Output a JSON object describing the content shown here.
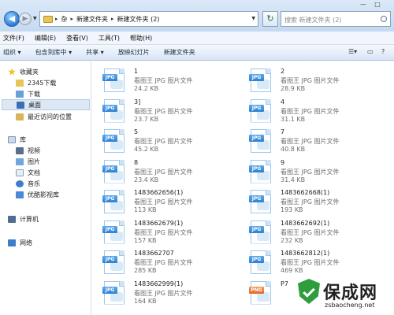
{
  "address": {
    "crumbs": [
      "杂",
      "新建文件夹",
      "新建文件夹 (2)"
    ],
    "search_placeholder": "搜索 新建文件夹 (2)"
  },
  "window": {
    "minimize": "—",
    "restore": "□"
  },
  "menu": [
    "文件(F)",
    "编辑(E)",
    "查看(V)",
    "工具(T)",
    "帮助(H)"
  ],
  "commands": [
    "组织 ▾",
    "包含到库中 ▾",
    "共享 ▾",
    "放映幻灯片",
    "新建文件夹"
  ],
  "view_controls": {
    "view": "☰▾",
    "preview": "▭",
    "help": "?"
  },
  "nav": {
    "favorites_title": "收藏夹",
    "favorites": [
      "2345下载",
      "下载",
      "桌面",
      "最近访问的位置"
    ],
    "libraries_title": "库",
    "libraries": [
      "视频",
      "图片",
      "文档",
      "音乐",
      "优酷影视库"
    ],
    "computer": "计算机",
    "network": "网络"
  },
  "files": [
    {
      "name": "1",
      "type": "看图王 JPG 图片文件",
      "size": "24.2 KB",
      "ext": "JPG"
    },
    {
      "name": "2",
      "type": "看图王 JPG 图片文件",
      "size": "28.9 KB",
      "ext": "JPG"
    },
    {
      "name": "3]",
      "type": "看图王 JPG 图片文件",
      "size": "23.7 KB",
      "ext": "JPG"
    },
    {
      "name": "4",
      "type": "看图王 JPG 图片文件",
      "size": "31.1 KB",
      "ext": "JPG"
    },
    {
      "name": "5",
      "type": "看图王 JPG 图片文件",
      "size": "45.2 KB",
      "ext": "JPG"
    },
    {
      "name": "7",
      "type": "看图王 JPG 图片文件",
      "size": "40.8 KB",
      "ext": "JPG"
    },
    {
      "name": "8",
      "type": "看图王 JPG 图片文件",
      "size": "23.4 KB",
      "ext": "JPG"
    },
    {
      "name": "9",
      "type": "看图王 JPG 图片文件",
      "size": "31.4 KB",
      "ext": "JPG"
    },
    {
      "name": "1483662656(1)",
      "type": "看图王 JPG 图片文件",
      "size": "113 KB",
      "ext": "JPG"
    },
    {
      "name": "1483662668(1)",
      "type": "看图王 JPG 图片文件",
      "size": "193 KB",
      "ext": "JPG"
    },
    {
      "name": "1483662679(1)",
      "type": "看图王 JPG 图片文件",
      "size": "157 KB",
      "ext": "JPG"
    },
    {
      "name": "1483662692(1)",
      "type": "看图王 JPG 图片文件",
      "size": "232 KB",
      "ext": "JPG"
    },
    {
      "name": "1483662707",
      "type": "看图王 JPG 图片文件",
      "size": "285 KB",
      "ext": "JPG"
    },
    {
      "name": "1483662812(1)",
      "type": "看图王 JPG 图片文件",
      "size": "469 KB",
      "ext": "JPG"
    },
    {
      "name": "1483662999(1)",
      "type": "看图王 JPG 图片文件",
      "size": "164 KB",
      "ext": "JPG"
    },
    {
      "name": "P7",
      "type": "",
      "size": "",
      "ext": "PNG"
    }
  ],
  "watermark": {
    "title": "保成网",
    "url": "zsbaocheng.net"
  }
}
